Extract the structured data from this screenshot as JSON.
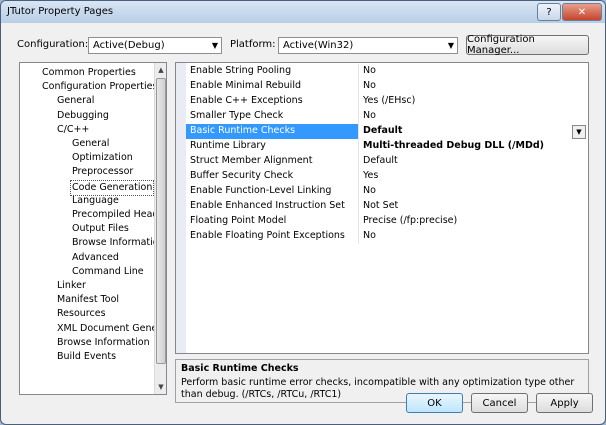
{
  "window": {
    "title": "JTutor Property Pages",
    "help_label": "?",
    "close_label": "✕"
  },
  "config": {
    "configuration_label": "Configuration:",
    "configuration_value": "Active(Debug)",
    "platform_label": "Platform:",
    "platform_value": "Active(Win32)",
    "manager_label": "Configuration Manager..."
  },
  "tree": {
    "items": [
      {
        "label": "Common Properties",
        "level": 1
      },
      {
        "label": "Configuration Properties",
        "level": 1
      },
      {
        "label": "General",
        "level": 2
      },
      {
        "label": "Debugging",
        "level": 2
      },
      {
        "label": "C/C++",
        "level": 2
      },
      {
        "label": "General",
        "level": 3
      },
      {
        "label": "Optimization",
        "level": 3
      },
      {
        "label": "Preprocessor",
        "level": 3
      },
      {
        "label": "Code Generation",
        "level": 3,
        "selected": true
      },
      {
        "label": "Language",
        "level": 3
      },
      {
        "label": "Precompiled Heade",
        "level": 3
      },
      {
        "label": "Output Files",
        "level": 3
      },
      {
        "label": "Browse Information",
        "level": 3
      },
      {
        "label": "Advanced",
        "level": 3
      },
      {
        "label": "Command Line",
        "level": 3
      },
      {
        "label": "Linker",
        "level": 2
      },
      {
        "label": "Manifest Tool",
        "level": 2
      },
      {
        "label": "Resources",
        "level": 2
      },
      {
        "label": "XML Document Genera",
        "level": 2
      },
      {
        "label": "Browse Information",
        "level": 2
      },
      {
        "label": "Build Events",
        "level": 2
      }
    ]
  },
  "properties": [
    {
      "name": "Enable String Pooling",
      "value": "No"
    },
    {
      "name": "Enable Minimal Rebuild",
      "value": "No"
    },
    {
      "name": "Enable C++ Exceptions",
      "value": "Yes (/EHsc)"
    },
    {
      "name": "Smaller Type Check",
      "value": "No"
    },
    {
      "name": "Basic Runtime Checks",
      "value": "Default",
      "selected": true,
      "bold": true
    },
    {
      "name": "Runtime Library",
      "value": "Multi-threaded Debug DLL (/MDd)",
      "bold": true
    },
    {
      "name": "Struct Member Alignment",
      "value": "Default"
    },
    {
      "name": "Buffer Security Check",
      "value": "Yes"
    },
    {
      "name": "Enable Function-Level Linking",
      "value": "No"
    },
    {
      "name": "Enable Enhanced Instruction Set",
      "value": "Not Set"
    },
    {
      "name": "Floating Point Model",
      "value": "Precise (/fp:precise)"
    },
    {
      "name": "Enable Floating Point Exceptions",
      "value": "No"
    }
  ],
  "description": {
    "title": "Basic Runtime Checks",
    "text": "Perform basic runtime error checks, incompatible with any optimization type other than debug. (/RTCs, /RTCu, /RTC1)"
  },
  "buttons": {
    "ok": "OK",
    "cancel": "Cancel",
    "apply": "Apply"
  }
}
